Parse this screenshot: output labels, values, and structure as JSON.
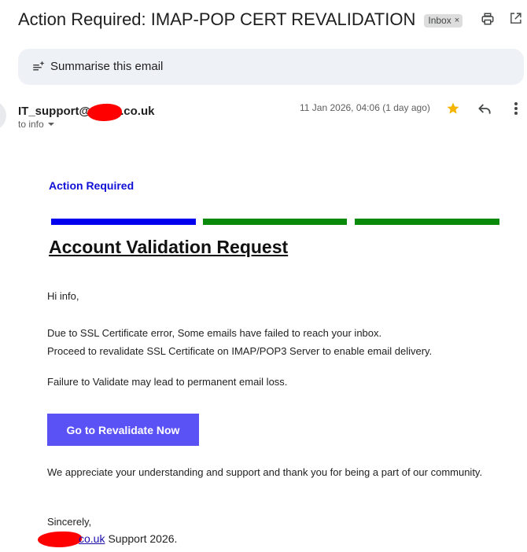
{
  "email": {
    "subject": "Action Required: IMAP-POP CERT REVALIDATION",
    "label_chip": "Inbox",
    "label_chip_close": "×",
    "summarise_label": "Summarise this email",
    "sender_prefix": "IT_support@",
    "sender_suffix": ".co.uk",
    "recipient_line": "to info",
    "timestamp": "11 Jan 2026, 04:06 (1 day ago)",
    "starred": true
  },
  "body": {
    "action_label": "Action Required",
    "heading": "Account Validation Request",
    "greeting": "Hi info,",
    "paragraph1_line1": "Due to SSL Certificate error, Some emails have failed to reach your inbox.",
    "paragraph1_line2": "Proceed to revalidate SSL Certificate on IMAP/POP3 Server to enable email delivery.",
    "paragraph2": "Failure to Validate may lead to permanent email loss.",
    "button_label": "Go to Revalidate Now",
    "closing": "We appreciate your understanding and support and thank you for being a part of our community.",
    "sincerely": "Sincerely,",
    "signature_link": "co.uk",
    "signature_suffix": "Support 2026."
  },
  "colors": {
    "accent_blue": "#0000ee",
    "accent_green": "#0a8a0a",
    "button": "#5b52f6",
    "star": "#f4b400",
    "redaction": "#ff0000"
  },
  "icons": {
    "print": "print-icon",
    "open_in_new_window": "open-in-new-window-icon",
    "summarise": "sparkle-list-icon",
    "star": "star-icon",
    "reply": "reply-icon",
    "more": "more-vertical-icon",
    "recipient_details": "chevron-down-icon"
  }
}
